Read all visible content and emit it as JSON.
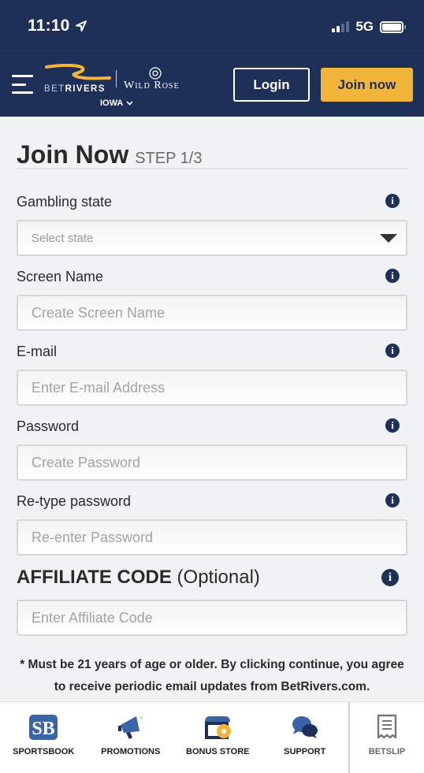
{
  "status_bar": {
    "time": "11:10",
    "network": "5G"
  },
  "header": {
    "brand_primary_prefix": "BET",
    "brand_primary_suffix": "RIVERS",
    "brand_secondary": "Wild Rose",
    "state_selector": "IOWA",
    "login_label": "Login",
    "join_label": "Join now"
  },
  "form": {
    "title": "Join Now",
    "step": "STEP 1/3",
    "fields": [
      {
        "label": "Gambling state",
        "placeholder": "Select state",
        "type": "select"
      },
      {
        "label": "Screen Name",
        "placeholder": "Create Screen Name",
        "type": "text"
      },
      {
        "label": "E-mail",
        "placeholder": "Enter E-mail Address",
        "type": "email"
      },
      {
        "label": "Password",
        "placeholder": "Create Password",
        "type": "password"
      },
      {
        "label": "Re-type password",
        "placeholder": "Re-enter Password",
        "type": "password"
      }
    ],
    "affiliate": {
      "label_bold": "AFFILIATE CODE",
      "label_optional": "(Optional)",
      "placeholder": "Enter Affiliate Code"
    },
    "disclaimer": "* Must be 21 years of age or older. By clicking continue, you agree to receive periodic email updates from BetRivers.com."
  },
  "tabbar": {
    "items": [
      {
        "label": "SPORTSBOOK",
        "icon": "sportsbook-icon"
      },
      {
        "label": "PROMOTIONS",
        "icon": "megaphone-icon"
      },
      {
        "label": "BONUS STORE",
        "icon": "store-icon"
      },
      {
        "label": "SUPPORT",
        "icon": "chat-bubbles-icon"
      },
      {
        "label": "BETSLIP",
        "icon": "receipt-icon"
      }
    ]
  },
  "colors": {
    "navy": "#1f3058",
    "gold": "#f2b53a",
    "blue_icon": "#3a64a8"
  }
}
